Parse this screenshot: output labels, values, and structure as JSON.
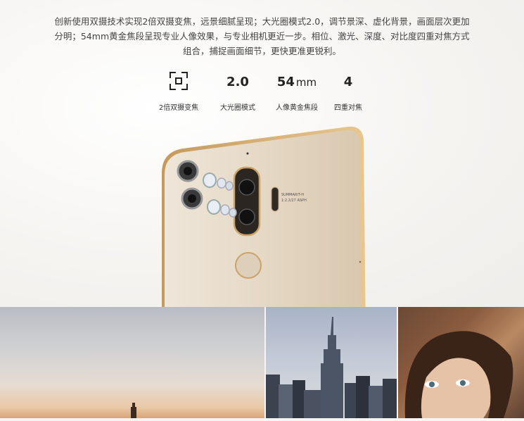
{
  "intro": {
    "line1": "创新使用双摄技术实现2倍双摄变焦，远景细腻呈现；大光圈模式2.0，调节景深、虚化背景，画面层次更加",
    "line2": "分明；54mm黄金焦段呈现专业人像效果，与专业相机更近一步。相位、激光、深度、对比度四重对焦方式",
    "line3": "组合，捕捉画面细节，更快更准更锐利。"
  },
  "stats": [
    {
      "icon": "focus-frame-icon",
      "label": "2倍双摄变焦"
    },
    {
      "value": "2.0",
      "label": "大光圈模式"
    },
    {
      "value": "54",
      "unit": "mm",
      "label": "人像黄金焦段"
    },
    {
      "value": "4",
      "label": "四重对焦"
    }
  ],
  "phone": {
    "lens_text_1": "SUMMARIT-H",
    "lens_text_2": "1:2.2/27 ASPH",
    "body_color": "#e3d6c3",
    "accent_color": "#c9a36a"
  },
  "photos": [
    "city-skyline-sunset",
    "empire-state-building",
    "woman-portrait"
  ]
}
